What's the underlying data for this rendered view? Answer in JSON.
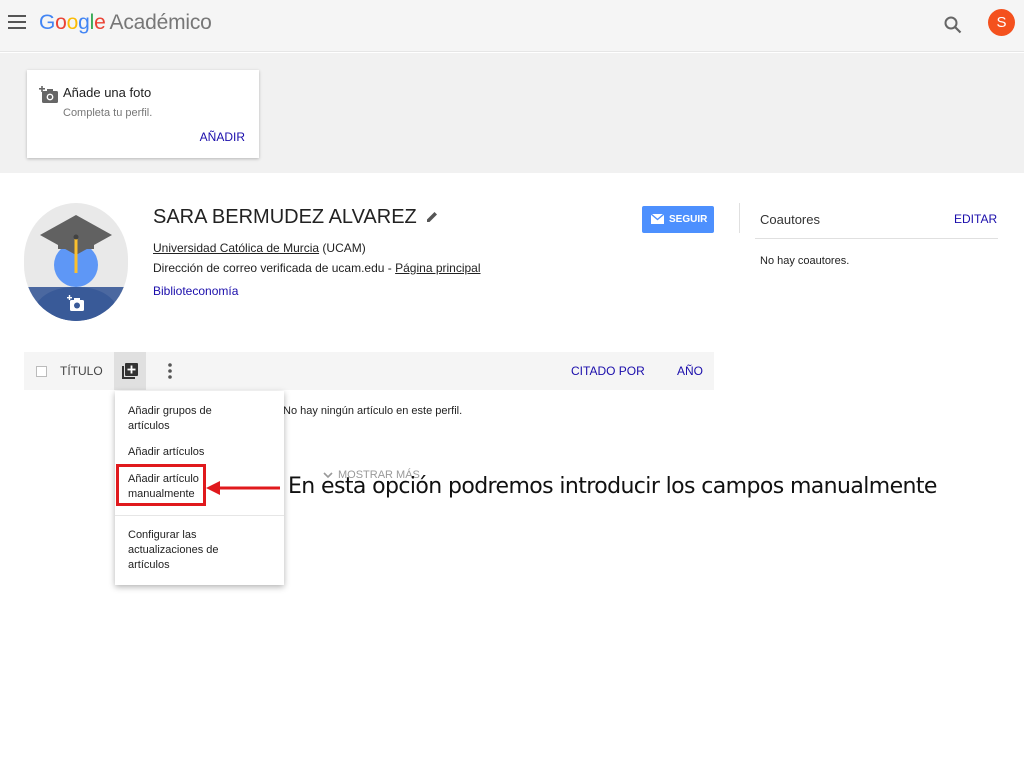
{
  "header": {
    "logo_letters": [
      "G",
      "o",
      "o",
      "g",
      "l",
      "e"
    ],
    "product": "Académico",
    "avatar_letter": "S",
    "avatar_color": "#f4511e"
  },
  "photo_prompt": {
    "title": "Añade una foto",
    "subtitle": "Completa tu perfil.",
    "action": "AÑADIR"
  },
  "profile": {
    "name": "SARA BERMUDEZ ALVAREZ",
    "affiliation_link": "Universidad Católica de Murcia",
    "affiliation_suffix": " (UCAM)",
    "email_text": "Dirección de correo verificada de ucam.edu - ",
    "homepage_link": "Página principal",
    "interest": "Biblioteconomía",
    "follow_label": "SEGUIR"
  },
  "coauthors": {
    "title": "Coautores",
    "edit": "EDITAR",
    "empty": "No hay coautores."
  },
  "articles_table": {
    "col_title": "TÍTULO",
    "col_cited": "CITADO POR",
    "col_year": "AÑO",
    "empty": "No hay ningún artículo en este perfil.",
    "show_more": "MOSTRAR MÁS"
  },
  "add_menu": {
    "items": [
      "Añadir grupos de artículos",
      "Añadir artículos",
      "Añadir artículo manualmente",
      "Configurar las actualizaciones de artículos"
    ],
    "highlighted_index": 2
  },
  "annotation": {
    "text": "En esta opción podremos introducir  los campos manualmente",
    "color": "#e0191d"
  }
}
